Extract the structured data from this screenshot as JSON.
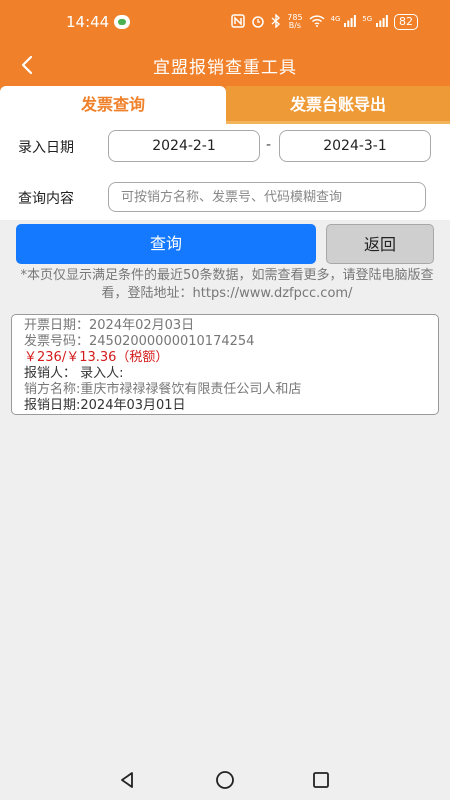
{
  "status_bar": {
    "time": "14:44",
    "speed_value": "785",
    "speed_unit": "B/s",
    "signal_1": "4G",
    "signal_2": "5G",
    "battery": "82"
  },
  "app_bar": {
    "title": "宜盟报销查重工具"
  },
  "tabs": {
    "active": "发票查询",
    "inactive": "发票台账导出"
  },
  "form": {
    "date_label": "录入日期",
    "date_start": "2024-2-1",
    "date_separator": "-",
    "date_end": "2024-3-1",
    "query_label": "查询内容",
    "query_placeholder": "可按销方名称、发票号、代码模糊查询",
    "query_value": ""
  },
  "buttons": {
    "query": "查询",
    "back": "返回"
  },
  "notice": "*本页仅显示满足条件的最近50条数据，如需查看更多，请登陆电脑版查看，登陆地址：https://www.dzfpcc.com/",
  "results": [
    {
      "issue_date": "开票日期：2024年02月03日",
      "invoice_no": "发票号码：24502000000010174254",
      "amount": "￥236/￥13.36（税额）",
      "people": "报销人：  录入人:",
      "seller": "销方名称:重庆市禄禄禄餐饮有限责任公司人和店",
      "reimburse_date": "报销日期:2024年03月01日"
    }
  ],
  "colors": {
    "brand": "#f0812a",
    "primary_button": "#1479ff",
    "amount_red": "#d41c1c"
  }
}
